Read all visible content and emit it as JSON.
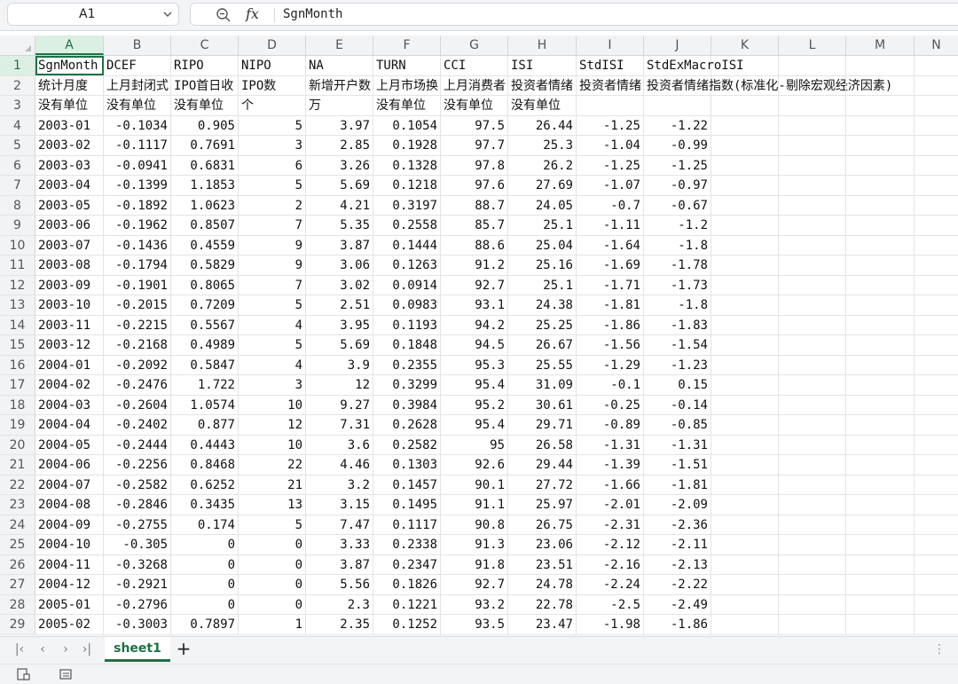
{
  "formula_bar": {
    "cell_reference": "A1",
    "formula_value": "SgnMonth"
  },
  "columns": [
    "A",
    "B",
    "C",
    "D",
    "E",
    "F",
    "G",
    "H",
    "I",
    "J",
    "K",
    "L",
    "M",
    "N"
  ],
  "rows": [
    [
      "SgnMonth",
      "DCEF",
      "RIPO",
      "NIPO",
      "NA",
      "TURN",
      "CCI",
      "ISI",
      "StdISI",
      "StdExMacroISI"
    ],
    [
      "统计月度",
      "上月封闭式",
      "IPO首日收",
      "IPO数",
      "新增开户数",
      "上月市场换",
      "上月消费者",
      "投资者情绪",
      "投资者情绪",
      "投资者情绪指数(标准化-剔除宏观经济因素)"
    ],
    [
      "没有单位",
      "没有单位",
      "没有单位",
      "个",
      "万",
      "没有单位",
      "没有单位",
      "没有单位",
      "",
      ""
    ],
    [
      "2003-01",
      "-0.1034",
      "0.905",
      "5",
      "3.97",
      "0.1054",
      "97.5",
      "26.44",
      "-1.25",
      "-1.22"
    ],
    [
      "2003-02",
      "-0.1117",
      "0.7691",
      "3",
      "2.85",
      "0.1928",
      "97.7",
      "25.3",
      "-1.04",
      "-0.99"
    ],
    [
      "2003-03",
      "-0.0941",
      "0.6831",
      "6",
      "3.26",
      "0.1328",
      "97.8",
      "26.2",
      "-1.25",
      "-1.25"
    ],
    [
      "2003-04",
      "-0.1399",
      "1.1853",
      "5",
      "5.69",
      "0.1218",
      "97.6",
      "27.69",
      "-1.07",
      "-0.97"
    ],
    [
      "2003-05",
      "-0.1892",
      "1.0623",
      "2",
      "4.21",
      "0.3197",
      "88.7",
      "24.05",
      "-0.7",
      "-0.67"
    ],
    [
      "2003-06",
      "-0.1962",
      "0.8507",
      "7",
      "5.35",
      "0.2558",
      "85.7",
      "25.1",
      "-1.11",
      "-1.2"
    ],
    [
      "2003-07",
      "-0.1436",
      "0.4559",
      "9",
      "3.87",
      "0.1444",
      "88.6",
      "25.04",
      "-1.64",
      "-1.8"
    ],
    [
      "2003-08",
      "-0.1794",
      "0.5829",
      "9",
      "3.06",
      "0.1263",
      "91.2",
      "25.16",
      "-1.69",
      "-1.78"
    ],
    [
      "2003-09",
      "-0.1901",
      "0.8065",
      "7",
      "3.02",
      "0.0914",
      "92.7",
      "25.1",
      "-1.71",
      "-1.73"
    ],
    [
      "2003-10",
      "-0.2015",
      "0.7209",
      "5",
      "2.51",
      "0.0983",
      "93.1",
      "24.38",
      "-1.81",
      "-1.8"
    ],
    [
      "2003-11",
      "-0.2215",
      "0.5567",
      "4",
      "3.95",
      "0.1193",
      "94.2",
      "25.25",
      "-1.86",
      "-1.83"
    ],
    [
      "2003-12",
      "-0.2168",
      "0.4989",
      "5",
      "5.69",
      "0.1848",
      "94.5",
      "26.67",
      "-1.56",
      "-1.54"
    ],
    [
      "2004-01",
      "-0.2092",
      "0.5847",
      "4",
      "3.9",
      "0.2355",
      "95.3",
      "25.55",
      "-1.29",
      "-1.23"
    ],
    [
      "2004-02",
      "-0.2476",
      "1.722",
      "3",
      "12",
      "0.3299",
      "95.4",
      "31.09",
      "-0.1",
      "0.15"
    ],
    [
      "2004-03",
      "-0.2604",
      "1.0574",
      "10",
      "9.27",
      "0.3984",
      "95.2",
      "30.61",
      "-0.25",
      "-0.14"
    ],
    [
      "2004-04",
      "-0.2402",
      "0.877",
      "12",
      "7.31",
      "0.2628",
      "95.4",
      "29.71",
      "-0.89",
      "-0.85"
    ],
    [
      "2004-05",
      "-0.2444",
      "0.4443",
      "10",
      "3.6",
      "0.2582",
      "95",
      "26.58",
      "-1.31",
      "-1.31"
    ],
    [
      "2004-06",
      "-0.2256",
      "0.8468",
      "22",
      "4.46",
      "0.1303",
      "92.6",
      "29.44",
      "-1.39",
      "-1.51"
    ],
    [
      "2004-07",
      "-0.2582",
      "0.6252",
      "21",
      "3.2",
      "0.1457",
      "90.1",
      "27.72",
      "-1.66",
      "-1.81"
    ],
    [
      "2004-08",
      "-0.2846",
      "0.3435",
      "13",
      "3.15",
      "0.1495",
      "91.1",
      "25.97",
      "-2.01",
      "-2.09"
    ],
    [
      "2004-09",
      "-0.2755",
      "0.174",
      "5",
      "7.47",
      "0.1117",
      "90.8",
      "26.75",
      "-2.31",
      "-2.36"
    ],
    [
      "2004-10",
      "-0.305",
      "0",
      "0",
      "3.33",
      "0.2338",
      "91.3",
      "23.06",
      "-2.12",
      "-2.11"
    ],
    [
      "2004-11",
      "-0.3268",
      "0",
      "0",
      "3.87",
      "0.2347",
      "91.8",
      "23.51",
      "-2.16",
      "-2.13"
    ],
    [
      "2004-12",
      "-0.2921",
      "0",
      "0",
      "5.56",
      "0.1826",
      "92.7",
      "24.78",
      "-2.24",
      "-2.22"
    ],
    [
      "2005-01",
      "-0.2796",
      "0",
      "0",
      "2.3",
      "0.1221",
      "93.2",
      "22.78",
      "-2.5",
      "-2.49"
    ],
    [
      "2005-02",
      "-0.3003",
      "0.7897",
      "1",
      "2.35",
      "0.1252",
      "93.5",
      "23.47",
      "-1.98",
      "-1.86"
    ]
  ],
  "sheet_tabs": [
    "sheet1"
  ],
  "add_sheet_label": "+",
  "nav_icons": [
    "first-sheet-icon",
    "prev-sheet-icon",
    "next-sheet-icon",
    "last-sheet-icon"
  ],
  "colors": {
    "accent": "#1e7145",
    "header_bg": "#f2f3f5",
    "selected_header_bg": "#dcefe3"
  }
}
